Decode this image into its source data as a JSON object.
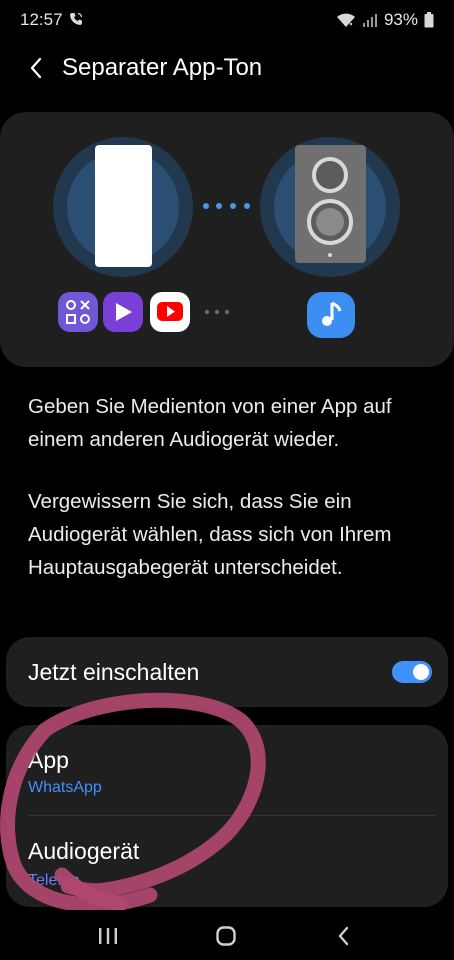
{
  "status_bar": {
    "time": "12:57",
    "battery": "93%",
    "icons": [
      "call-icon",
      "wifi-icon",
      "signal-icon",
      "battery-icon"
    ]
  },
  "header": {
    "title": "Separater App-Ton",
    "back_icon": "chevron-left-icon"
  },
  "illustration": {
    "app_icons": [
      "game-launcher-icon",
      "play-icon",
      "youtube-icon"
    ],
    "music_icon": "music-note-icon"
  },
  "description": {
    "paragraph1": "Geben Sie Medienton von einer App auf einem anderen Audiogerät wieder.",
    "paragraph2": "Vergewissern Sie sich, dass Sie ein Audiogerät wählen, dass sich von Ihrem Hauptausgabegerät unterscheidet."
  },
  "toggle": {
    "label": "Jetzt einschalten",
    "enabled": true
  },
  "settings": {
    "app": {
      "title": "App",
      "value": "WhatsApp"
    },
    "audio_device": {
      "title": "Audiogerät",
      "value": "Telefon"
    }
  },
  "colors": {
    "accent": "#3e91ff",
    "card_bg": "#1f1f1f",
    "annotation": "#b0486f"
  },
  "nav_bar": {
    "buttons": [
      "recents-icon",
      "home-icon",
      "back-icon"
    ]
  }
}
